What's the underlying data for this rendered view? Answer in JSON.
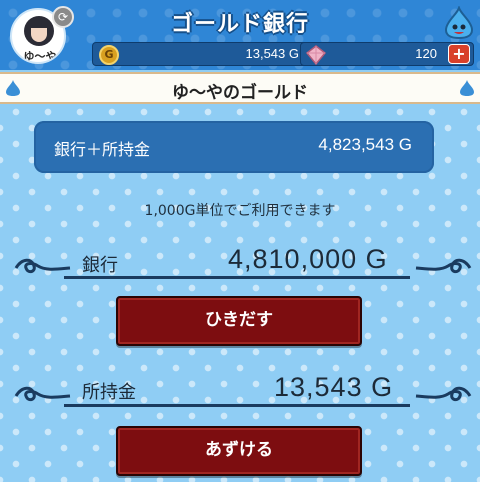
{
  "header": {
    "title": "ゴールド銀行",
    "avatar_name": "ゆ～や",
    "avatar_badge_icon": "swap-icon",
    "slime_icon": "slime-icon",
    "gold_icon": "gold-coin-icon",
    "gold_icon_glyph": "G",
    "gold_amount": "13,543 G",
    "gem_icon": "gem-icon",
    "gem_amount": "120",
    "plus_glyph": "+"
  },
  "banner": {
    "title": "ゆ～やのゴールド"
  },
  "total": {
    "label": "銀行＋所持金",
    "value": "4,823,543 G"
  },
  "note": "1,000G単位でご利用できます",
  "bank": {
    "label": "銀行",
    "value": "4,810,000 G",
    "button_label": "ひきだす"
  },
  "wallet": {
    "label": "所持金",
    "value": "13,543 G",
    "button_label": "あずける"
  },
  "colors": {
    "header_blue": "#2f86d6",
    "background_blue": "#8fcdf4",
    "button_red": "#7d0d10",
    "panel_blue": "#2b6fb2"
  }
}
